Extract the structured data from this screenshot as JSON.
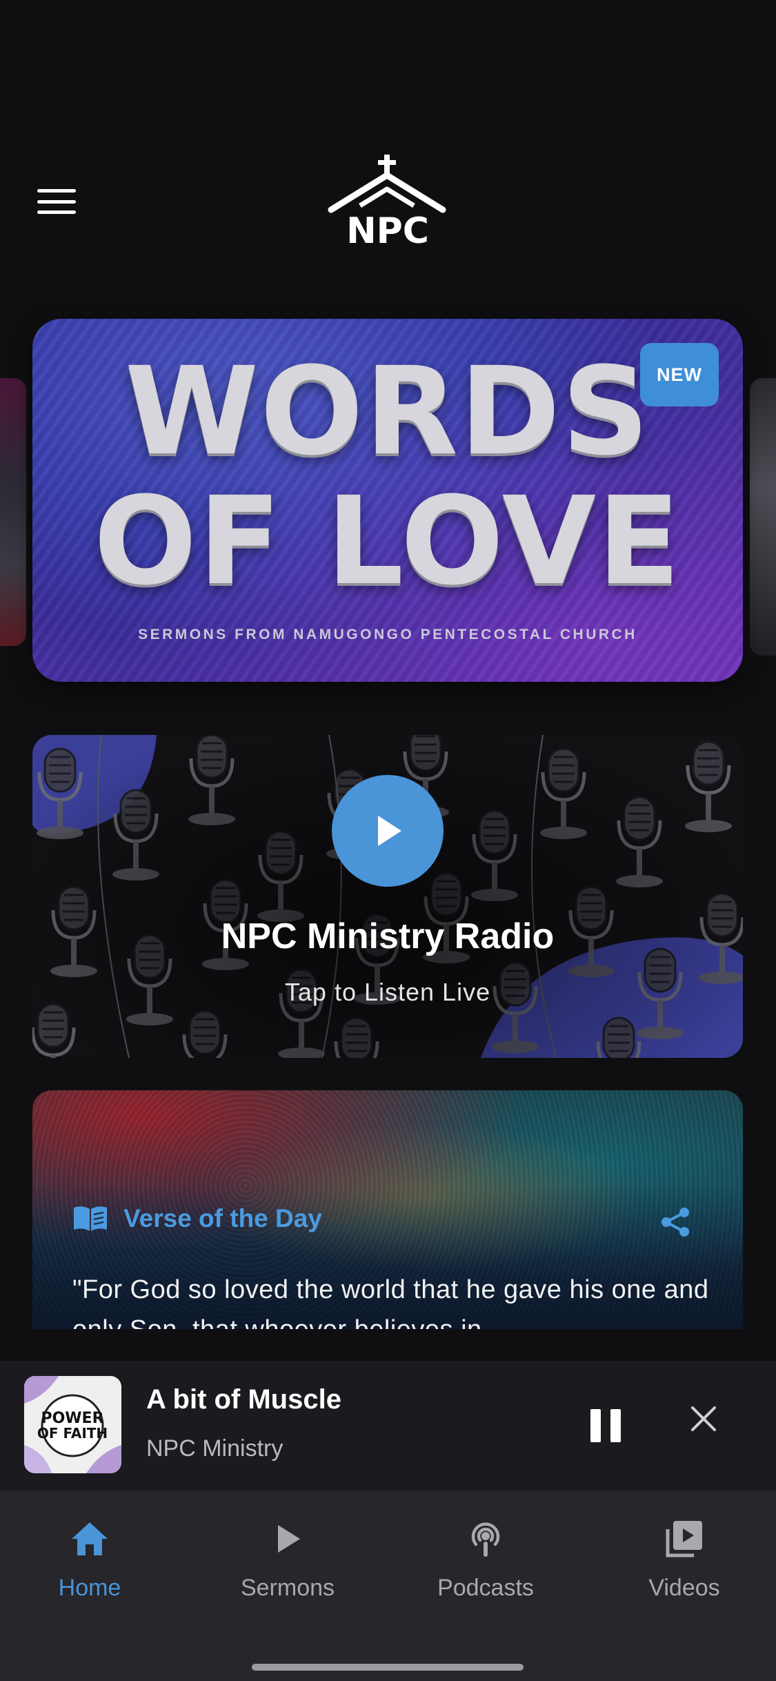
{
  "header": {
    "logo_text": "NPC",
    "menu_icon": "hamburger-menu-icon"
  },
  "hero": {
    "line1": "WORDS",
    "line2": "OF LOVE",
    "subtitle": "SERMONS FROM NAMUGONGO PENTECOSTAL CHURCH",
    "badge": "NEW"
  },
  "radio": {
    "title": "NPC Ministry Radio",
    "subtitle": "Tap to Listen Live",
    "icon": "play-icon"
  },
  "verse": {
    "label": "Verse of the Day",
    "text": "\"For God so loved the world that he gave his one and only Son, that whoever believes in",
    "icon": "book-icon",
    "share_icon": "share-icon"
  },
  "player": {
    "album_text_1": "POWER",
    "album_text_2": "OF FAITH",
    "title": "A bit of Muscle",
    "artist": "NPC Ministry",
    "pause_icon": "pause-icon",
    "close_icon": "close-icon"
  },
  "tabs": [
    {
      "label": "Home",
      "icon": "home-icon",
      "active": true
    },
    {
      "label": "Sermons",
      "icon": "play-icon",
      "active": false
    },
    {
      "label": "Podcasts",
      "icon": "podcast-icon",
      "active": false
    },
    {
      "label": "Videos",
      "icon": "video-library-icon",
      "active": false
    }
  ],
  "colors": {
    "background": "#0f0f11",
    "accent": "#4a94d8",
    "tab_bar": "#26262b",
    "player_bg": "#1b1b1f"
  }
}
